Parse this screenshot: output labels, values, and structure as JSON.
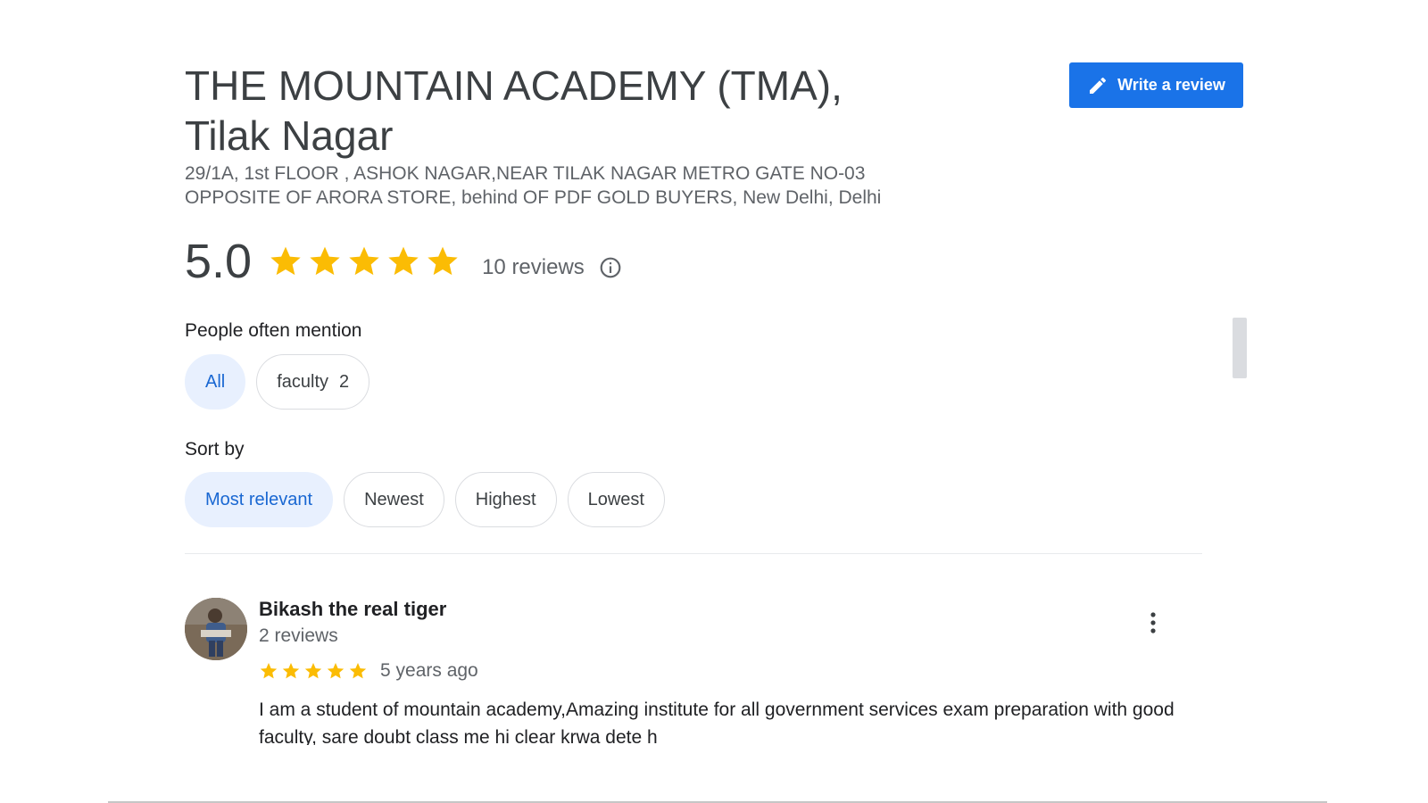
{
  "place": {
    "title_line1": "THE MOUNTAIN ACADEMY (TMA),",
    "title_line2": "Tilak Nagar",
    "address_line1": "29/1A, 1st FLOOR , ASHOK NAGAR,NEAR TILAK NAGAR METRO GATE NO-03",
    "address_line2": "OPPOSITE OF ARORA STORE, behind OF PDF GOLD BUYERS, New Delhi, Delhi"
  },
  "write_review": {
    "label": "Write a review",
    "icon": "pencil-icon"
  },
  "summary": {
    "rating": "5.0",
    "stars": 5,
    "review_count": "10 reviews",
    "info_icon": "info-icon"
  },
  "mentions": {
    "label": "People often mention",
    "chips": [
      {
        "label": "All",
        "count": "",
        "active": true
      },
      {
        "label": "faculty",
        "count": "2",
        "active": false
      }
    ]
  },
  "sort": {
    "label": "Sort by",
    "options": [
      {
        "label": "Most relevant",
        "active": true
      },
      {
        "label": "Newest",
        "active": false
      },
      {
        "label": "Highest",
        "active": false
      },
      {
        "label": "Lowest",
        "active": false
      }
    ]
  },
  "reviews": [
    {
      "name": "Bikash the real tiger",
      "meta": "2 reviews",
      "stars": 5,
      "date": "5 years ago",
      "text": "I am a student of mountain academy,Amazing institute for all government services exam preparation with good faculty, sare doubt class me hi clear krwa dete h"
    }
  ],
  "colors": {
    "star": "#fbbc04",
    "accent": "#1a73e8",
    "chip_active_bg": "#e8f0fe",
    "chip_active_text": "#1967d2"
  }
}
